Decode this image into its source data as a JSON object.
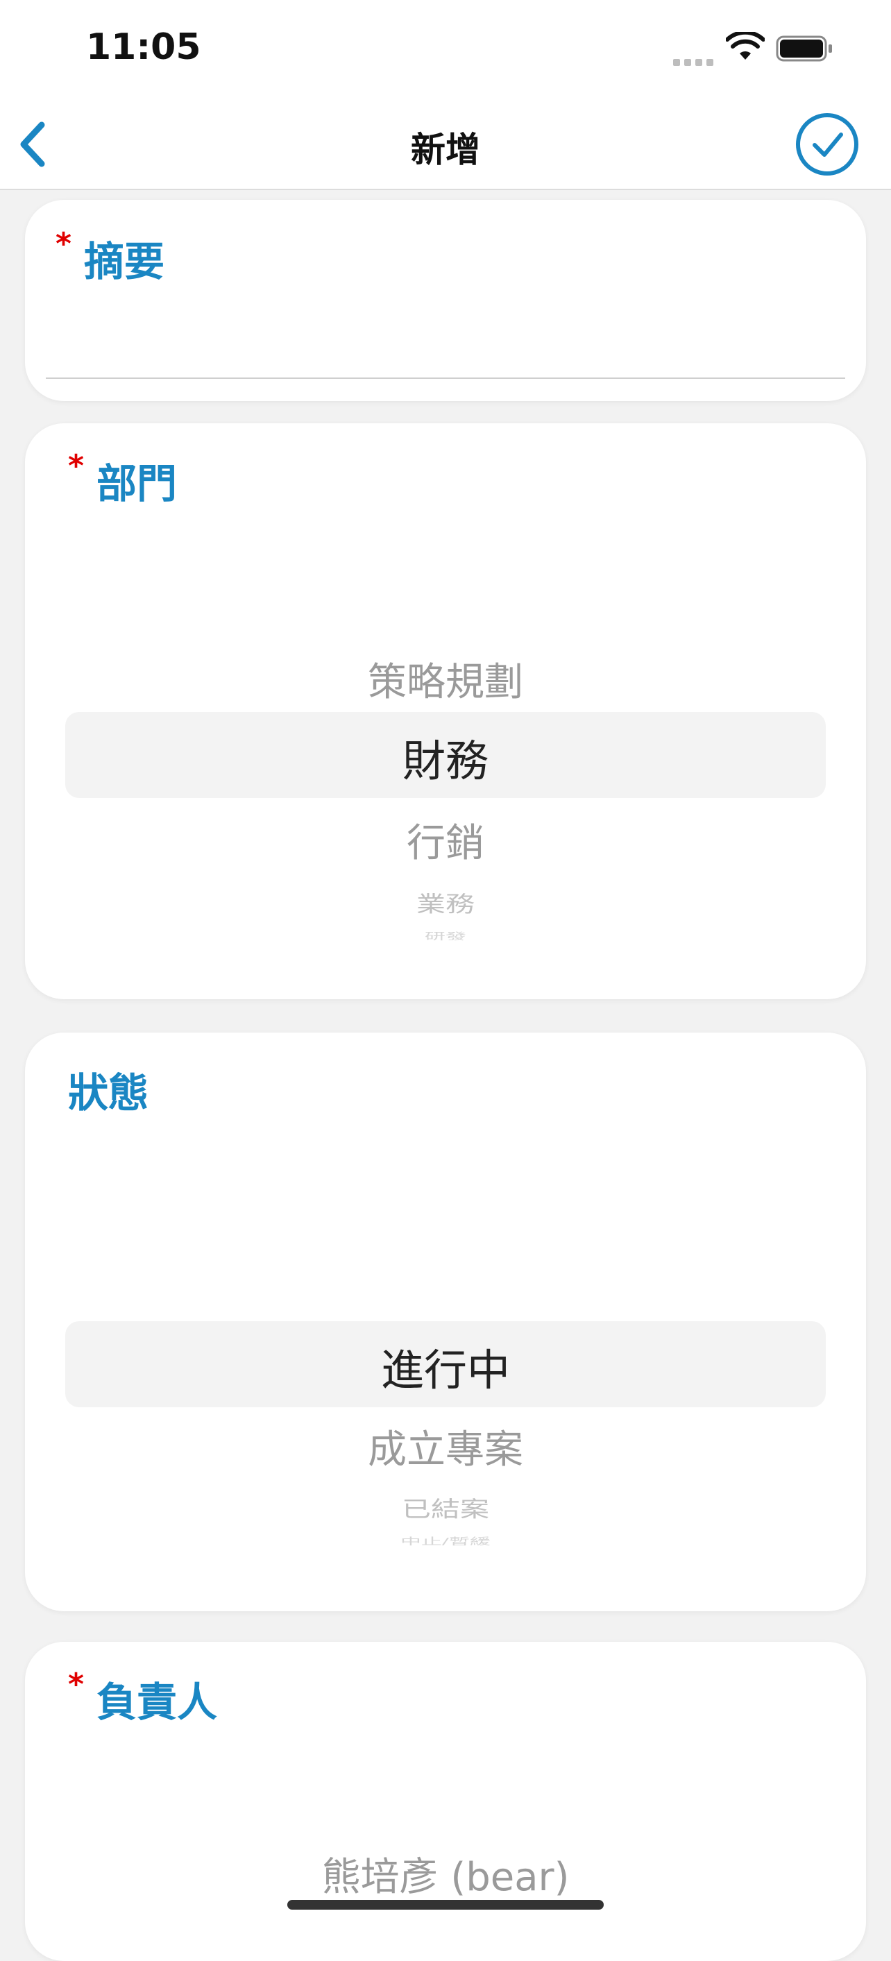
{
  "status_bar": {
    "time": "11:05"
  },
  "nav": {
    "title": "新增"
  },
  "summary": {
    "label": "摘要",
    "required_mark": "*",
    "value": ""
  },
  "department": {
    "label": "部門",
    "required_mark": "*",
    "options_above": [
      "策略規劃"
    ],
    "selected": "財務",
    "options_below": [
      "行銷",
      "業務",
      "研發"
    ]
  },
  "status": {
    "label": "狀態",
    "selected": "進行中",
    "options_below": [
      "成立專案",
      "已結案",
      "中止/暫緩"
    ]
  },
  "owner": {
    "label": "負責人",
    "required_mark": "*",
    "visible_option": "熊培彥 (bear)"
  },
  "colors": {
    "accent": "#1a86c3",
    "required": "#e00000"
  },
  "icons": [
    "back-chevron-icon",
    "check-circle-icon",
    "wifi-icon",
    "battery-icon",
    "cellular-signal-icon"
  ]
}
